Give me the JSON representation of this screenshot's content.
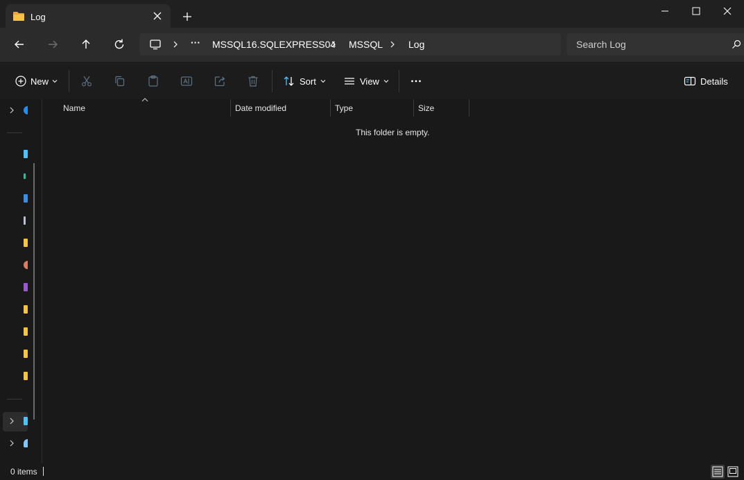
{
  "tab": {
    "title": "Log",
    "icon": "folder-icon"
  },
  "address": {
    "crumbs": [
      "MSSQL16.SQLEXPRESS04",
      "MSSQL",
      "Log"
    ],
    "overflow_label": "···"
  },
  "search": {
    "placeholder": "Search Log"
  },
  "toolbar": {
    "new_label": "New",
    "sort_label": "Sort",
    "view_label": "View",
    "details_label": "Details"
  },
  "columns": [
    "Name",
    "Date modified",
    "Type",
    "Size"
  ],
  "content": {
    "empty_message": "This folder is empty."
  },
  "status": {
    "item_count": "0 items"
  },
  "colors": {
    "folder": "#f6c343",
    "accent": "#4cc2ff",
    "background": "#191919"
  }
}
